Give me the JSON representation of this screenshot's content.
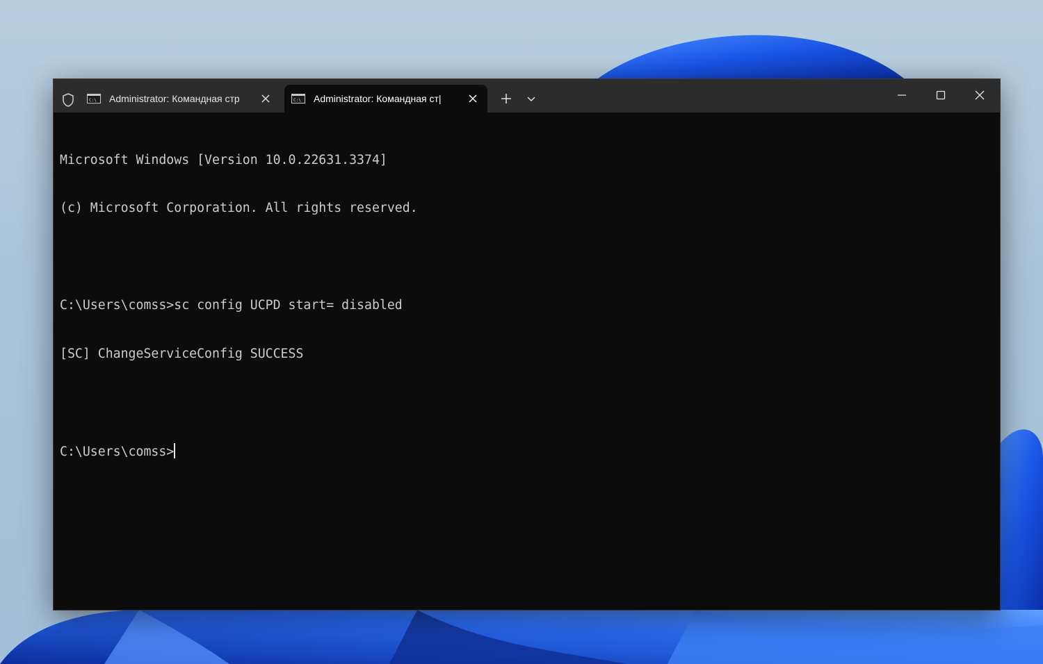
{
  "window": {
    "tabs": [
      {
        "title": "Administrator: Командная стр",
        "icon": "cmd-icon",
        "active": false
      },
      {
        "title": "Administrator: Командная ст|",
        "icon": "cmd-icon",
        "active": true
      }
    ],
    "controls": [
      "new-tab-icon",
      "tab-dropdown-icon",
      "minimize-icon",
      "maximize-icon",
      "close-icon"
    ]
  },
  "terminal": {
    "lines": [
      "Microsoft Windows [Version 10.0.22631.3374]",
      "(c) Microsoft Corporation. All rights reserved.",
      "",
      "C:\\Users\\comss>sc config UCPD start= disabled",
      "[SC] ChangeServiceConfig SUCCESS",
      "",
      "C:\\Users\\comss>"
    ]
  },
  "colors": {
    "terminal_bg": "#0c0c0c",
    "titlebar_bg": "#2c2c2c",
    "text": "#cccccc",
    "wallpaper_blue": "#1f5fe0"
  }
}
